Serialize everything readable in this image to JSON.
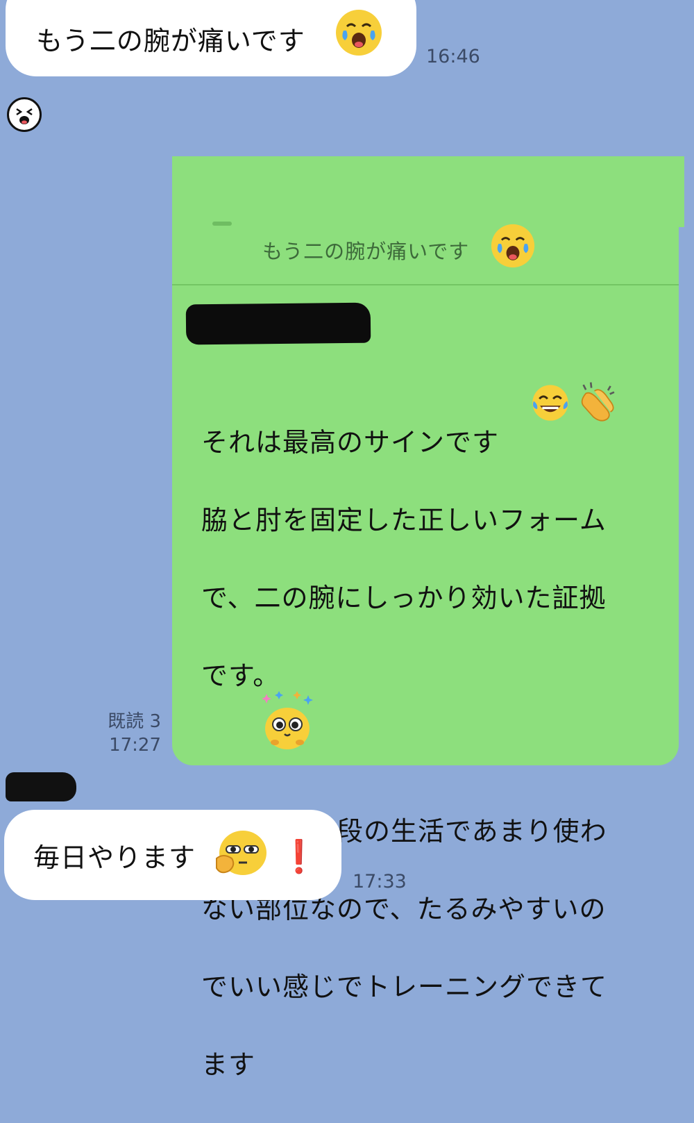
{
  "messages": {
    "first": {
      "text": "もう二の腕が痛いです",
      "time": "16:46",
      "emoji": "tears-of-joy-face-icon"
    },
    "reply": {
      "quoted_text": "もう二の腕が痛いです",
      "lines": [
        "それは最高のサインです",
        "脇と肘を固定した正しいフォーム",
        "で、二の腕にしっかり効いた証拠",
        "です。",
        "",
        "二の腕は普段の生活であまり使わ",
        "ない部位なので、たるみやすいの",
        "でいい感じでトレーニングできて",
        "ます"
      ],
      "read_status": "既読 3",
      "time": "17:27"
    },
    "last": {
      "text": "毎日やります",
      "exclaim": "❗",
      "time": "17:33"
    }
  },
  "colors": {
    "background": "#8eaad8",
    "outgoing_bubble": "#8ddf7d",
    "incoming_bubble": "#ffffff"
  }
}
